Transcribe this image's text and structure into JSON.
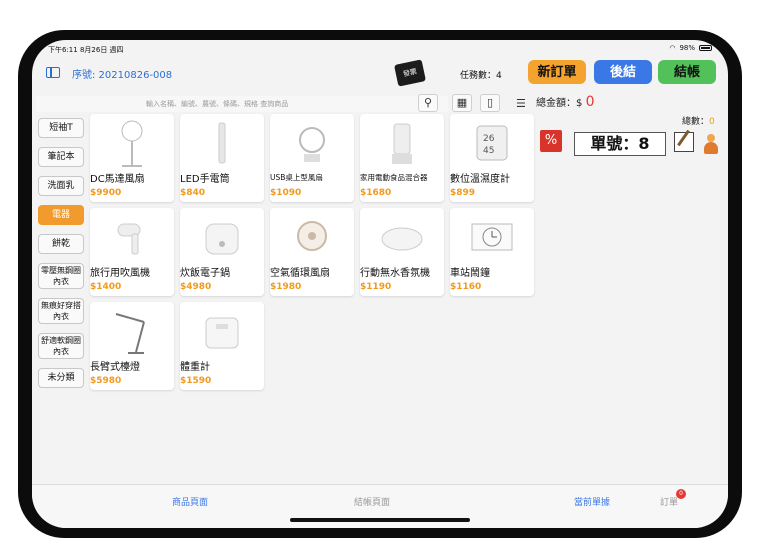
{
  "status": {
    "time": "下午6:11",
    "date": "8月26日 週四",
    "battery": "98%"
  },
  "header": {
    "serial": "序號: 20210826-008",
    "stamp_text": "發票",
    "task_count": "任務數：4"
  },
  "buttons": {
    "new_order": "新訂單",
    "checkout": "後結",
    "bill": "結帳"
  },
  "search": {
    "placeholder": "輸入名稱、編號、農號、條碼、規格 查詢商品"
  },
  "summary": {
    "total_label": "總金額：$",
    "total_value": "0",
    "count_label": "總數：",
    "count_value": "0"
  },
  "order": {
    "number": "單號：8",
    "discount_icon": "%"
  },
  "categories": [
    {
      "label": "短袖T"
    },
    {
      "label": "筆記本"
    },
    {
      "label": "洗面乳"
    },
    {
      "label": "電器"
    },
    {
      "label": "餅乾"
    },
    {
      "label": "零壓無鋼圈內衣"
    },
    {
      "label": "無痕好穿搭內衣"
    },
    {
      "label": "舒適軟鋼圈內衣"
    },
    {
      "label": "未分類"
    }
  ],
  "products": [
    {
      "name": "DC馬達風扇",
      "price": "$9900",
      "icon": "fan-icon"
    },
    {
      "name": "LED手電筒",
      "price": "$840",
      "icon": "flashlight-icon"
    },
    {
      "name": "USB桌上型風扇",
      "price": "$1090",
      "icon": "desk-fan-icon"
    },
    {
      "name": "家用電動食品混合器",
      "price": "$1680",
      "icon": "blender-icon"
    },
    {
      "name": "數位溫濕度計",
      "price": "$899",
      "icon": "hygrometer-icon"
    },
    {
      "name": "旅行用吹風機",
      "price": "$1400",
      "icon": "hair-dryer-icon"
    },
    {
      "name": "炊飯電子鍋",
      "price": "$4980",
      "icon": "rice-cooker-icon"
    },
    {
      "name": "空氣循環風扇",
      "price": "$1980",
      "icon": "circulator-fan-icon"
    },
    {
      "name": "行動無水香氛機",
      "price": "$1190",
      "icon": "diffuser-icon"
    },
    {
      "name": "車站鬧鐘",
      "price": "$1160",
      "icon": "clock-icon"
    },
    {
      "name": "長臂式檯燈",
      "price": "$5980",
      "icon": "desk-lamp-icon"
    },
    {
      "name": "體重計",
      "price": "$1590",
      "icon": "scale-icon"
    }
  ],
  "tabs": {
    "products": "商品頁面",
    "checkout": "結帳頁面",
    "current": "當前單據",
    "orders": "訂單",
    "orders_badge": "0"
  },
  "colors": {
    "accent_orange": "#f29a1c",
    "accent_blue": "#3a78e6",
    "accent_green": "#52c15a",
    "total_red": "#e53935"
  }
}
